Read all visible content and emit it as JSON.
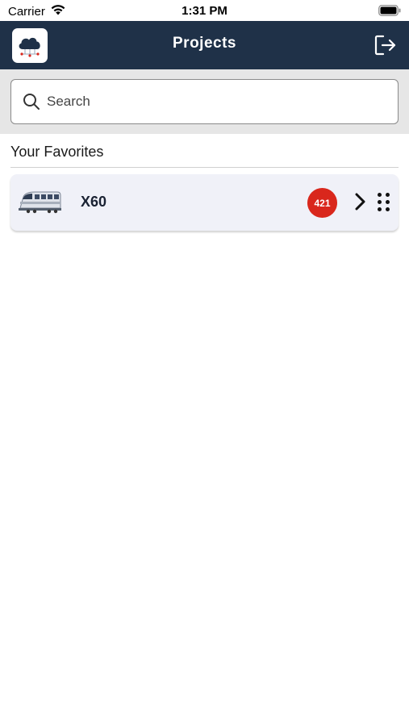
{
  "status_bar": {
    "carrier": "Carrier",
    "time": "1:31 PM"
  },
  "nav": {
    "title": "Projects"
  },
  "search": {
    "placeholder": "Search",
    "value": ""
  },
  "favorites": {
    "header": "Your Favorites",
    "items": [
      {
        "name": "X60",
        "badge_count": "421",
        "icon": "train-icon"
      }
    ]
  },
  "colors": {
    "nav_background": "#1f3148",
    "badge": "#d9271c",
    "card_background": "#f0f1f8",
    "search_area_background": "#e6e6e6"
  }
}
